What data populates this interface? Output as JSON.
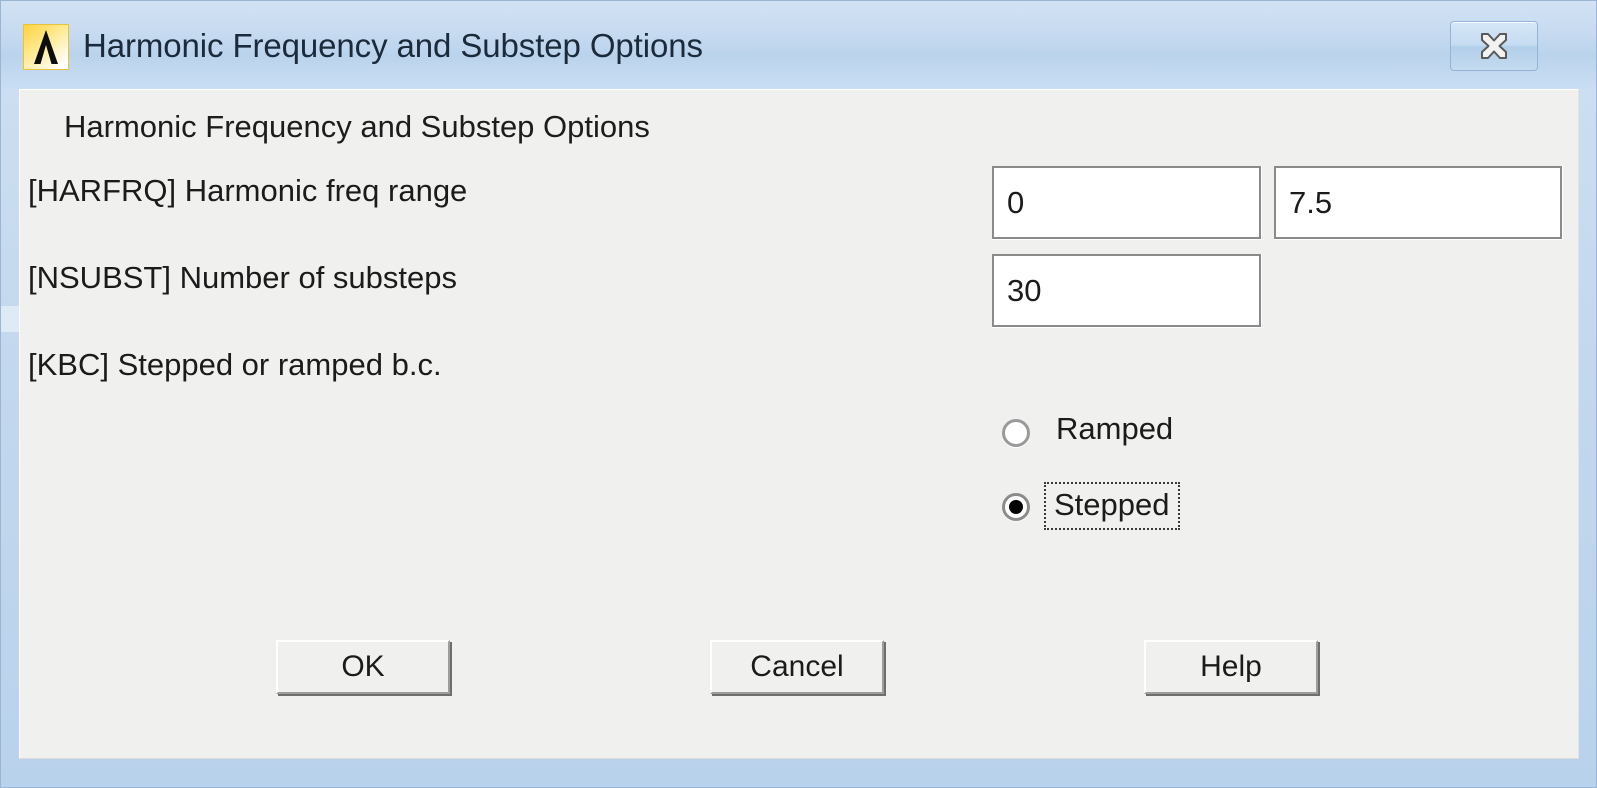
{
  "window": {
    "title": "Harmonic Frequency and Substep Options",
    "logo_icon": "ansys-logo-icon",
    "close_icon": "close-icon",
    "frame_color": "#c3d8ee",
    "titlebar_color": "#c6daf0",
    "panel_color": "#f0f0ef"
  },
  "content": {
    "heading": "Harmonic Frequency and Substep Options",
    "fields": [
      {
        "label": "[HARFRQ]  Harmonic freq range",
        "values": [
          "0",
          "7.5"
        ],
        "placeholders": [
          "",
          ""
        ]
      },
      {
        "label": "[NSUBST]  Number of substeps",
        "values": [
          "30"
        ],
        "placeholders": [
          ""
        ]
      },
      {
        "label": "[KBC]    Stepped or ramped b.c.",
        "values": [],
        "placeholders": []
      }
    ],
    "radio_group": {
      "name": "kbc",
      "options": [
        {
          "label": "Ramped",
          "selected": false,
          "focused": false
        },
        {
          "label": "Stepped",
          "selected": true,
          "focused": true
        }
      ]
    }
  },
  "buttons": {
    "ok": "OK",
    "cancel": "Cancel",
    "help": "Help"
  }
}
